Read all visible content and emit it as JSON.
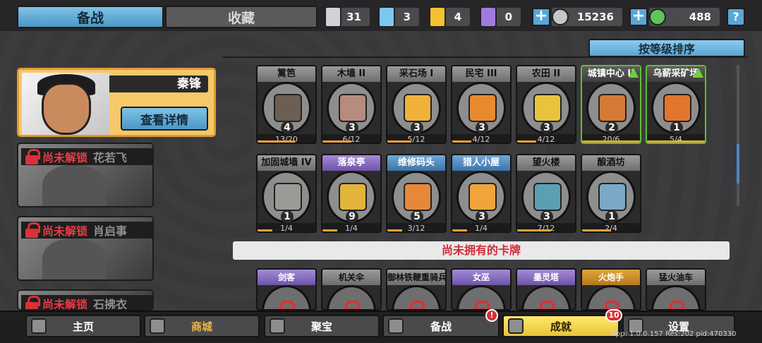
{
  "tabs": [
    {
      "label": "备战",
      "active": true
    },
    {
      "label": "收藏",
      "active": false
    }
  ],
  "resources": [
    {
      "name": "silver-shield",
      "value": "31",
      "color": "#cfd3d8"
    },
    {
      "name": "blue-crystal",
      "value": "3",
      "color": "#7ec8f0"
    },
    {
      "name": "gold-shield",
      "value": "4",
      "color": "#f2c230"
    },
    {
      "name": "purple-shield",
      "value": "0",
      "color": "#9f7be0"
    }
  ],
  "currency": [
    {
      "name": "silver-coin",
      "value": "15236",
      "color": "#c7c7c7"
    },
    {
      "name": "green-gem",
      "value": "488",
      "color": "#5fc45a"
    }
  ],
  "help_label": "?",
  "sort_label": "按等级排序",
  "hero_main": {
    "name": "秦锋",
    "detail_label": "查看详情"
  },
  "heroes_locked": [
    {
      "status": "尚未解锁",
      "name": "花若飞"
    },
    {
      "status": "尚未解锁",
      "name": "肖启事"
    },
    {
      "status": "尚未解锁",
      "name": "石拂衣"
    }
  ],
  "cards_row1": [
    {
      "title": "篱笆",
      "level": "4",
      "progress": "13/20",
      "fill": 0.65,
      "color": "#6b5e52"
    },
    {
      "title": "木墙 II",
      "level": "3",
      "progress": "6/12",
      "fill": 0.5,
      "color": "#b78b7e"
    },
    {
      "title": "采石场 I",
      "level": "3",
      "progress": "5/12",
      "fill": 0.42,
      "color": "#f0b13a"
    },
    {
      "title": "民宅 III",
      "level": "3",
      "progress": "4/12",
      "fill": 0.33,
      "color": "#e88a30"
    },
    {
      "title": "农田 II",
      "level": "3",
      "progress": "4/12",
      "fill": 0.33,
      "color": "#e9c33e"
    },
    {
      "title": "城镇中心 II",
      "level": "2",
      "progress": "20/6",
      "fill": 1.0,
      "color": "#d47a36",
      "upgrade": true
    },
    {
      "title": "乌薪采矿场",
      "level": "1",
      "progress": "5/4",
      "fill": 1.0,
      "color": "#e2762c",
      "upgrade": true
    }
  ],
  "cards_row2": [
    {
      "title": "加固城墙 IV",
      "level": "1",
      "progress": "1/4",
      "fill": 0.25,
      "color": "#9c9a95"
    },
    {
      "title": "落泉亭",
      "level": "9",
      "progress": "1/4",
      "fill": 0.25,
      "color": "#e3b43c",
      "kind": "purple"
    },
    {
      "title": "维修码头",
      "level": "5",
      "progress": "3/12",
      "fill": 0.25,
      "color": "#e5883a",
      "kind": "blue"
    },
    {
      "title": "猎人小屋",
      "level": "3",
      "progress": "1/4",
      "fill": 0.25,
      "color": "#f0a43a",
      "kind": "blue"
    },
    {
      "title": "望火楼",
      "level": "3",
      "progress": "7/12",
      "fill": 0.58,
      "color": "#5aa0b5"
    },
    {
      "title": "酿酒坊",
      "level": "1",
      "progress": "2/4",
      "fill": 0.5,
      "color": "#7aa9c8"
    }
  ],
  "unowned_label": "尚未拥有的卡牌",
  "cards_locked": [
    {
      "title": "剑客",
      "kind": "purple"
    },
    {
      "title": "机关伞",
      "kind": ""
    },
    {
      "title": "御林铁鞭重骑兵",
      "kind": ""
    },
    {
      "title": "女巫",
      "kind": "purple"
    },
    {
      "title": "墨灵塔",
      "kind": "purple"
    },
    {
      "title": "火炮手",
      "kind": "gold"
    },
    {
      "title": "猛火油车",
      "kind": ""
    }
  ],
  "nav": [
    {
      "label": "主页",
      "icon": "home-icon"
    },
    {
      "label": "商城",
      "icon": "coins-icon"
    },
    {
      "label": "聚宝",
      "icon": "treasure-icon"
    },
    {
      "label": "备战",
      "icon": "cards-icon",
      "badge": "!"
    },
    {
      "label": "成就",
      "icon": "grid-icon",
      "active": true,
      "badge": "10"
    },
    {
      "label": "设置",
      "icon": "gear-icon"
    }
  ],
  "watermark": "App: 1.0.0.157 Res:202 pid:470330"
}
